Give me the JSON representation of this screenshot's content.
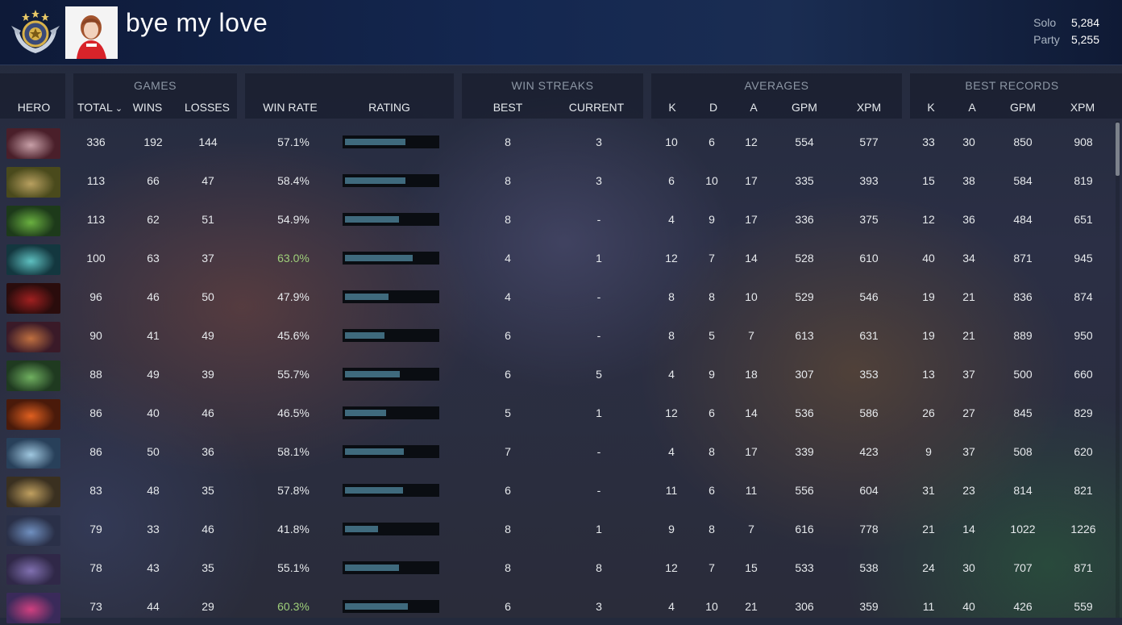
{
  "header": {
    "player_name": "bye my love",
    "mmr": [
      {
        "label": "Solo",
        "value": "5,284"
      },
      {
        "label": "Party",
        "value": "5,255"
      }
    ]
  },
  "groups": {
    "games": "GAMES",
    "win_streaks": "WIN STREAKS",
    "averages": "AVERAGES",
    "best_records": "BEST RECORDS"
  },
  "columns": {
    "hero": "HERO",
    "total": "TOTAL",
    "wins": "WINS",
    "losses": "LOSSES",
    "win_rate": "WIN RATE",
    "rating": "RATING",
    "best": "BEST",
    "current": "CURRENT",
    "avg_k": "K",
    "avg_d": "D",
    "avg_a": "A",
    "avg_gpm": "GPM",
    "avg_xpm": "XPM",
    "best_k": "K",
    "best_a": "A",
    "best_gpm": "GPM",
    "best_xpm": "XPM"
  },
  "colors": {
    "highlight_win_rate": "#9fd07a",
    "rating_bar": "#3f6a7d"
  },
  "rows": [
    {
      "hero_icon": "invoker-portrait-icon",
      "total": "336",
      "wins": "192",
      "losses": "144",
      "win_rate": "57.1%",
      "highlight": false,
      "rating": 0.66,
      "best": "8",
      "current": "3",
      "avg_k": "10",
      "avg_d": "6",
      "avg_a": "12",
      "avg_gpm": "554",
      "avg_xpm": "577",
      "best_k": "33",
      "best_a": "30",
      "best_gpm": "850",
      "best_xpm": "908"
    },
    {
      "hero_icon": "tinker-portrait-icon",
      "total": "113",
      "wins": "66",
      "losses": "47",
      "win_rate": "58.4%",
      "highlight": false,
      "rating": 0.66,
      "best": "8",
      "current": "3",
      "avg_k": "6",
      "avg_d": "10",
      "avg_a": "17",
      "avg_gpm": "335",
      "avg_xpm": "393",
      "best_k": "15",
      "best_a": "38",
      "best_gpm": "584",
      "best_xpm": "819"
    },
    {
      "hero_icon": "rubick-portrait-icon",
      "total": "113",
      "wins": "62",
      "losses": "51",
      "win_rate": "54.9%",
      "highlight": false,
      "rating": 0.59,
      "best": "8",
      "current": "-",
      "avg_k": "4",
      "avg_d": "9",
      "avg_a": "17",
      "avg_gpm": "336",
      "avg_xpm": "375",
      "best_k": "12",
      "best_a": "36",
      "best_gpm": "484",
      "best_xpm": "651"
    },
    {
      "hero_icon": "puck-portrait-icon",
      "total": "100",
      "wins": "63",
      "losses": "37",
      "win_rate": "63.0%",
      "highlight": true,
      "rating": 0.74,
      "best": "4",
      "current": "1",
      "avg_k": "12",
      "avg_d": "7",
      "avg_a": "14",
      "avg_gpm": "528",
      "avg_xpm": "610",
      "best_k": "40",
      "best_a": "34",
      "best_gpm": "871",
      "best_xpm": "945"
    },
    {
      "hero_icon": "shadow-fiend-portrait-icon",
      "total": "96",
      "wins": "46",
      "losses": "50",
      "win_rate": "47.9%",
      "highlight": false,
      "rating": 0.47,
      "best": "4",
      "current": "-",
      "avg_k": "8",
      "avg_d": "8",
      "avg_a": "10",
      "avg_gpm": "529",
      "avg_xpm": "546",
      "best_k": "19",
      "best_a": "21",
      "best_gpm": "836",
      "best_xpm": "874"
    },
    {
      "hero_icon": "anti-mage-portrait-icon",
      "total": "90",
      "wins": "41",
      "losses": "49",
      "win_rate": "45.6%",
      "highlight": false,
      "rating": 0.43,
      "best": "6",
      "current": "-",
      "avg_k": "8",
      "avg_d": "5",
      "avg_a": "7",
      "avg_gpm": "613",
      "avg_xpm": "631",
      "best_k": "19",
      "best_a": "21",
      "best_gpm": "889",
      "best_xpm": "950"
    },
    {
      "hero_icon": "leshrac-portrait-icon",
      "total": "88",
      "wins": "49",
      "losses": "39",
      "win_rate": "55.7%",
      "highlight": false,
      "rating": 0.6,
      "best": "6",
      "current": "5",
      "avg_k": "4",
      "avg_d": "9",
      "avg_a": "18",
      "avg_gpm": "307",
      "avg_xpm": "353",
      "best_k": "13",
      "best_a": "37",
      "best_gpm": "500",
      "best_xpm": "660"
    },
    {
      "hero_icon": "ember-spirit-portrait-icon",
      "total": "86",
      "wins": "40",
      "losses": "46",
      "win_rate": "46.5%",
      "highlight": false,
      "rating": 0.45,
      "best": "5",
      "current": "1",
      "avg_k": "12",
      "avg_d": "6",
      "avg_a": "14",
      "avg_gpm": "536",
      "avg_xpm": "586",
      "best_k": "26",
      "best_a": "27",
      "best_gpm": "845",
      "best_xpm": "829"
    },
    {
      "hero_icon": "crystal-maiden-portrait-icon",
      "total": "86",
      "wins": "50",
      "losses": "36",
      "win_rate": "58.1%",
      "highlight": false,
      "rating": 0.64,
      "best": "7",
      "current": "-",
      "avg_k": "4",
      "avg_d": "8",
      "avg_a": "17",
      "avg_gpm": "339",
      "avg_xpm": "423",
      "best_k": "9",
      "best_a": "37",
      "best_gpm": "508",
      "best_xpm": "620"
    },
    {
      "hero_icon": "clinkz-portrait-icon",
      "total": "83",
      "wins": "48",
      "losses": "35",
      "win_rate": "57.8%",
      "highlight": false,
      "rating": 0.63,
      "best": "6",
      "current": "-",
      "avg_k": "11",
      "avg_d": "6",
      "avg_a": "11",
      "avg_gpm": "556",
      "avg_xpm": "604",
      "best_k": "31",
      "best_a": "23",
      "best_gpm": "814",
      "best_xpm": "821"
    },
    {
      "hero_icon": "meepo-portrait-icon",
      "total": "79",
      "wins": "33",
      "losses": "46",
      "win_rate": "41.8%",
      "highlight": false,
      "rating": 0.36,
      "best": "8",
      "current": "1",
      "avg_k": "9",
      "avg_d": "8",
      "avg_a": "7",
      "avg_gpm": "616",
      "avg_xpm": "778",
      "best_k": "21",
      "best_a": "14",
      "best_gpm": "1022",
      "best_xpm": "1226"
    },
    {
      "hero_icon": "spectre-portrait-icon",
      "total": "78",
      "wins": "43",
      "losses": "35",
      "win_rate": "55.1%",
      "highlight": false,
      "rating": 0.59,
      "best": "8",
      "current": "8",
      "avg_k": "12",
      "avg_d": "7",
      "avg_a": "15",
      "avg_gpm": "533",
      "avg_xpm": "538",
      "best_k": "24",
      "best_a": "30",
      "best_gpm": "707",
      "best_xpm": "871"
    },
    {
      "hero_icon": "skywrath-mage-portrait-icon",
      "total": "73",
      "wins": "44",
      "losses": "29",
      "win_rate": "60.3%",
      "highlight": true,
      "rating": 0.68,
      "best": "6",
      "current": "3",
      "avg_k": "4",
      "avg_d": "10",
      "avg_a": "21",
      "avg_gpm": "306",
      "avg_xpm": "359",
      "best_k": "11",
      "best_a": "40",
      "best_gpm": "426",
      "best_xpm": "559"
    }
  ]
}
